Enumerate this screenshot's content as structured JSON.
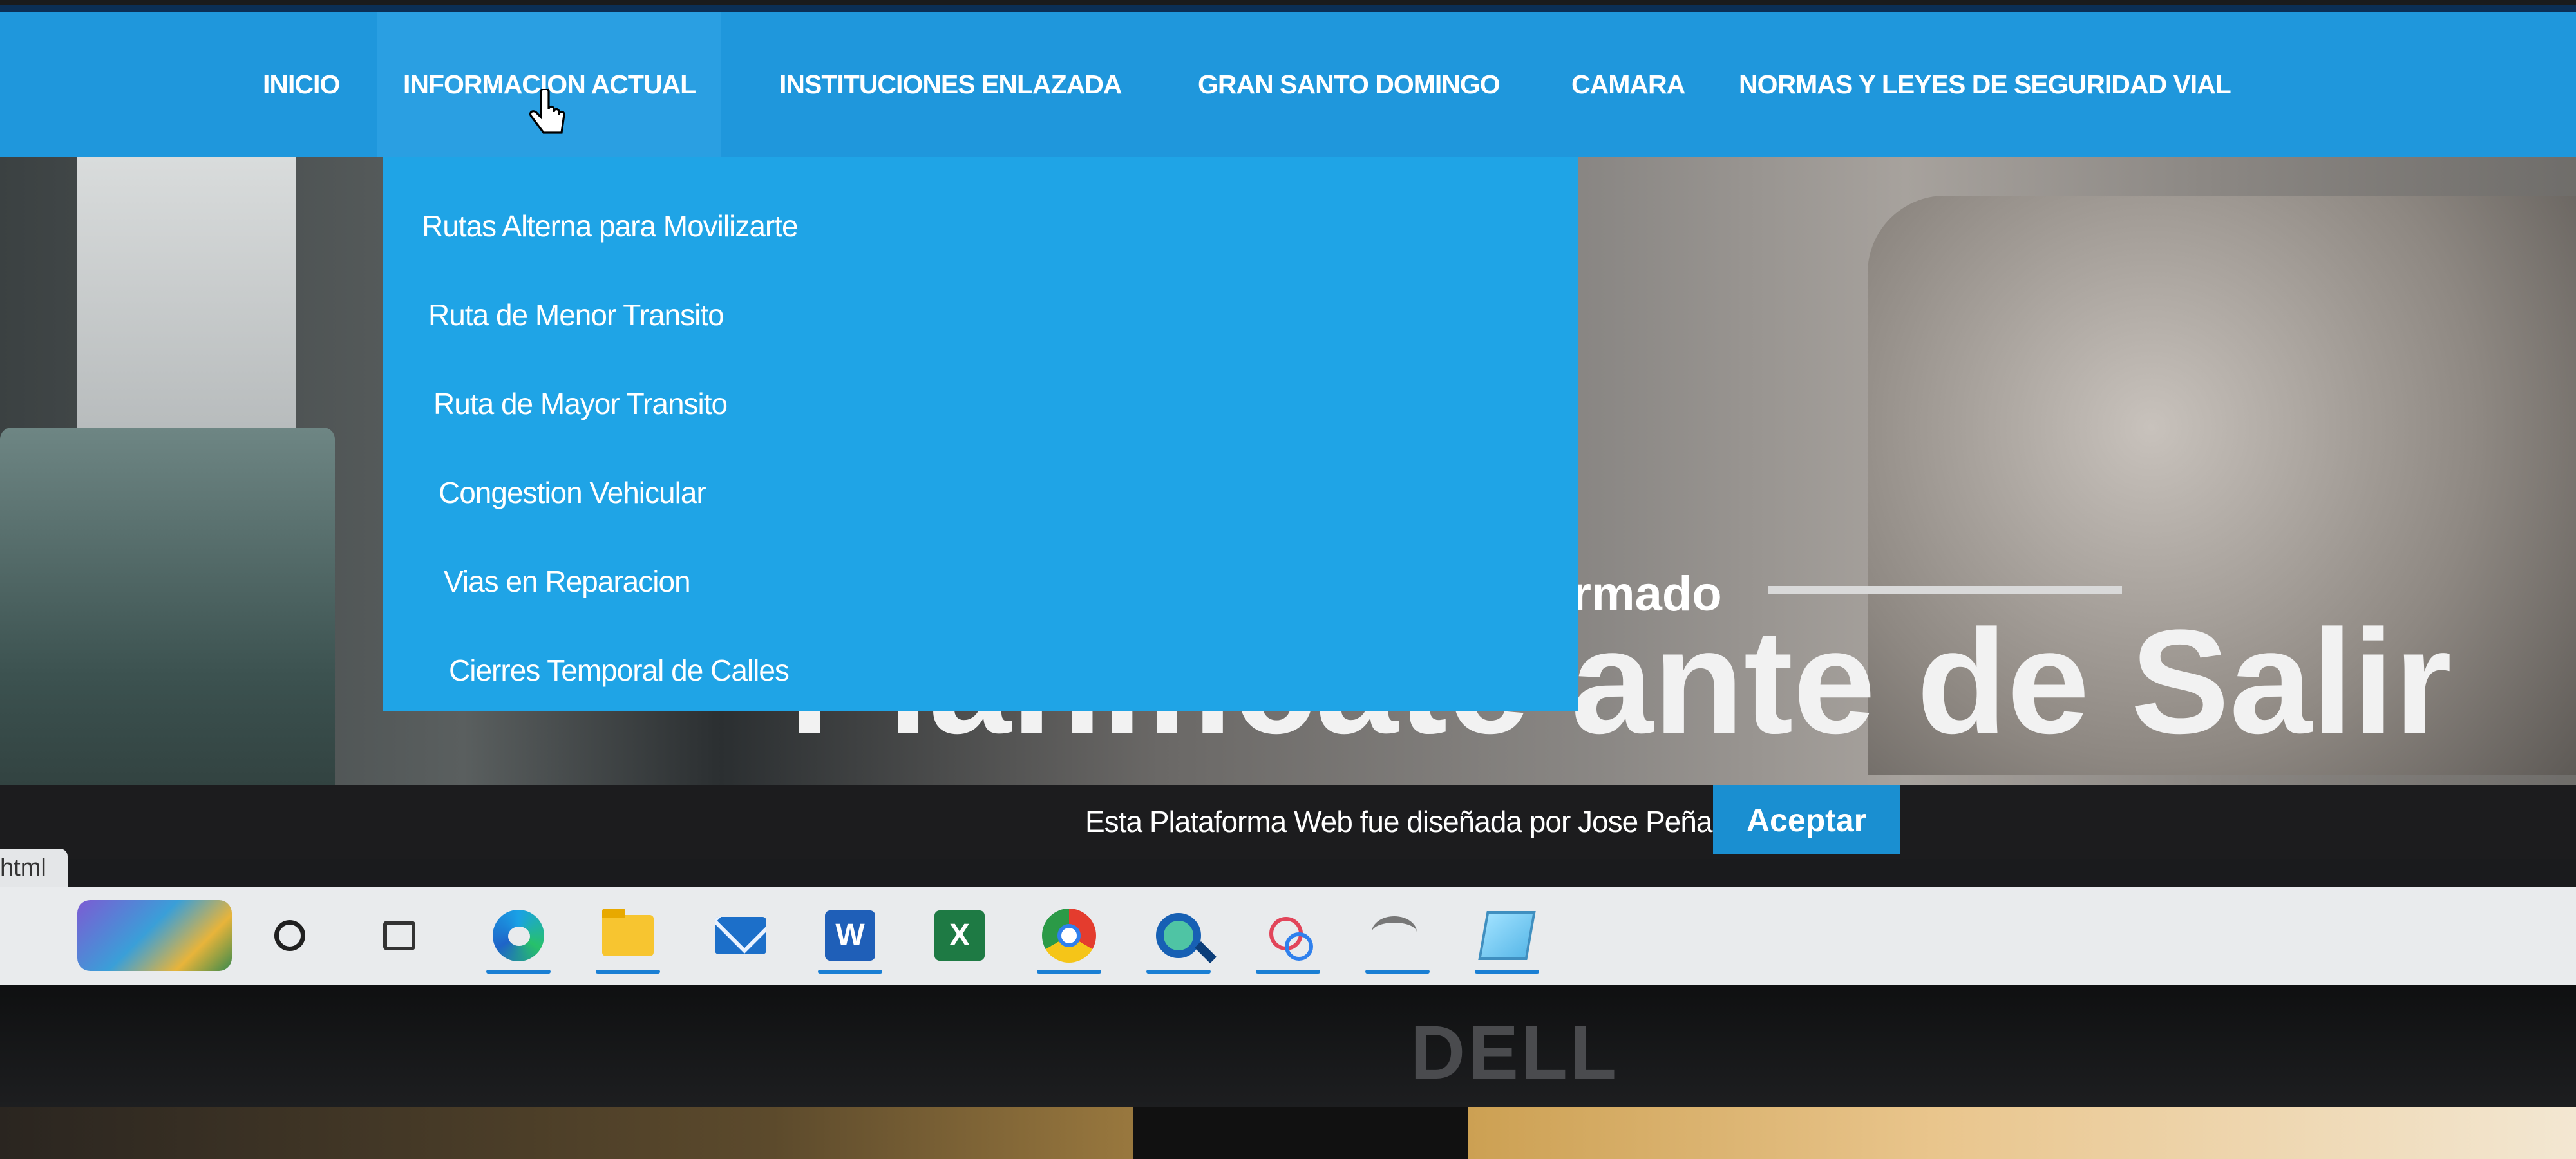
{
  "nav": {
    "items": [
      {
        "label": "INICIO"
      },
      {
        "label": "INFORMACION ACTUAL"
      },
      {
        "label": "INSTITUCIONES ENLAZADA"
      },
      {
        "label": "GRAN SANTO DOMINGO"
      },
      {
        "label": "CAMARA"
      },
      {
        "label": "NORMAS Y LEYES DE SEGURIDAD VIAL"
      }
    ]
  },
  "dropdown": {
    "items": [
      {
        "label": "Rutas Alterna para Movilizarte"
      },
      {
        "label": "Ruta de Menor Transito"
      },
      {
        "label": "Ruta de Mayor Transito"
      },
      {
        "label": "Congestion Vehicular"
      },
      {
        "label": "Vias en Reparacion"
      },
      {
        "label": "Cierres Temporal de Calles"
      }
    ]
  },
  "hero": {
    "subtitle_fragment": "ormado",
    "title": "Planificate ante de Salir"
  },
  "cookie": {
    "text": "Esta Plataforma Web fue diseñada por Jose Peña",
    "accept_label": "Aceptar"
  },
  "tab_snippet": "html",
  "taskbar": {
    "word_letter": "W",
    "excel_letter": "X"
  },
  "brand": {
    "monitor": "DELL"
  },
  "colors": {
    "nav_bg": "#1f97dc",
    "dropdown_bg": "#1fa4e6",
    "accept_bg": "#1a8fd1"
  }
}
